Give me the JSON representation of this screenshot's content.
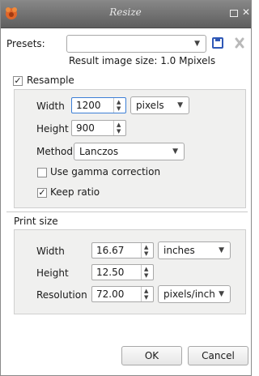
{
  "window": {
    "title": "Resize"
  },
  "presets": {
    "label": "Presets:",
    "value": ""
  },
  "result": {
    "text": "Result image size: 1.0 Mpixels"
  },
  "resample": {
    "label": "Resample",
    "checked": true
  },
  "resample_group": {
    "width_label": "Width",
    "width_value": "1200",
    "unit": "pixels",
    "height_label": "Height",
    "height_value": "900",
    "method_label": "Method",
    "method_value": "Lanczos",
    "gamma_label": "Use gamma correction",
    "gamma_checked": false,
    "keep_ratio_label": "Keep ratio",
    "keep_ratio_checked": true
  },
  "print": {
    "section_label": "Print size",
    "width_label": "Width",
    "width_value": "16.67",
    "width_unit": "inches",
    "height_label": "Height",
    "height_value": "12.50",
    "resolution_label": "Resolution",
    "resolution_value": "72.00",
    "resolution_unit": "pixels/inch"
  },
  "buttons": {
    "ok": "OK",
    "cancel": "Cancel"
  },
  "colors": {
    "save_icon": "#2f58b6",
    "delete_icon": "#b9b9b9",
    "app_icon": "#e0662a"
  }
}
